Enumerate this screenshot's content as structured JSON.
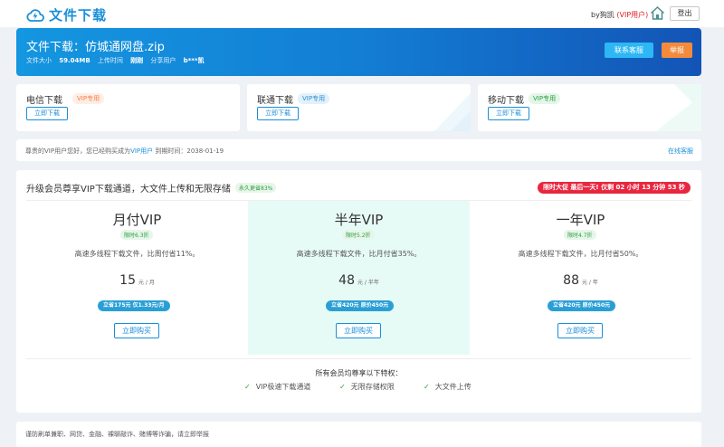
{
  "header": {
    "logo_text": "文件下载",
    "user_name": "by狗凯",
    "user_vip": "(VIP用户)",
    "logout_label": "登出"
  },
  "banner": {
    "title": "文件下载：仿城通网盘.zip",
    "size_label": "文件大小",
    "size_value": "59.04MB",
    "upload_label": "上传时间",
    "upload_value": "刚刚",
    "sharer_label": "分享用户",
    "sharer_value": "b***凯",
    "service_label": "联系客服",
    "report_label": "举报"
  },
  "download_options": [
    {
      "name": "电信下载",
      "tag": "VIP专用",
      "tag_color": "#ff7a45",
      "tag_bg": "#fdeee6",
      "button": "立即下载"
    },
    {
      "name": "联通下载",
      "tag": "VIP专用",
      "tag_color": "#2a8fd4",
      "tag_bg": "#e3f1fb",
      "button": "立即下载"
    },
    {
      "name": "移动下载",
      "tag": "VIP专用",
      "tag_color": "#2f9c3f",
      "tag_bg": "#e3f6e8",
      "button": "立即下载"
    }
  ],
  "vip_notice": {
    "prefix": "尊贵的VIP用户您好，您已经购买成为",
    "link": "VIP用户",
    "suffix": " 到期时间：2038-01-19",
    "service": "在线客服"
  },
  "upgrade": {
    "title": "升级会员尊享VIP下载通道，大文件上传和无限存储",
    "badge": "永久更省83%",
    "timer": "限时大促 最后一天! 仅剩 02 小时 13 分钟 53 秒",
    "plans": [
      {
        "name": "月付VIP",
        "discount": "限时6.3折",
        "desc": "高速多线程下载文件，比周付省11%。",
        "price": "15",
        "unit": "元 / 月",
        "save": "立省175元 仅1.33元/月",
        "buy": "立即购买"
      },
      {
        "name": "半年VIP",
        "discount": "限时5.2折",
        "desc": "高速多线程下载文件，比月付省35%。",
        "price": "48",
        "unit": "元 / 半年",
        "save": "立省420元 原价450元",
        "buy": "立即购买"
      },
      {
        "name": "一年VIP",
        "discount": "限时4.7折",
        "desc": "高速多线程下载文件，比月付省50%。",
        "price": "88",
        "unit": "元 / 年",
        "save": "立省420元 原价450元",
        "buy": "立即购买"
      }
    ],
    "privileges_title": "所有会员均尊享以下特权：",
    "privileges": [
      "VIP极速下载通道",
      "无限存储权限",
      "大文件上传"
    ]
  },
  "footer_notice": "谨防刷单兼职、网贷、金融、裸聊敲诈、赌博等诈骗，请立即举报"
}
